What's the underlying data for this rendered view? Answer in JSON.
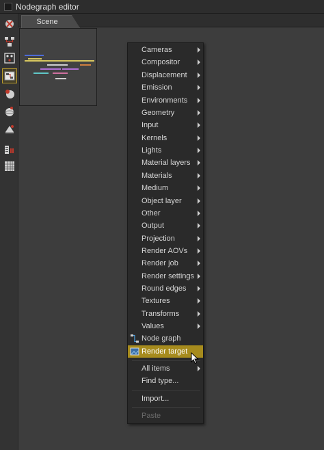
{
  "window": {
    "title": "Nodegraph editor"
  },
  "tabs": [
    {
      "label": "Scene"
    }
  ],
  "toolbar": {
    "tools": [
      {
        "name": "render-icon"
      },
      {
        "name": "nodes-icon"
      },
      {
        "name": "grid-nodes-icon"
      },
      {
        "name": "graph-icon",
        "active": true
      },
      {
        "name": "material-icon"
      },
      {
        "name": "sphere-icon"
      },
      {
        "name": "texture-icon"
      },
      {
        "name": "layers-icon"
      },
      {
        "name": "table-icon"
      }
    ]
  },
  "menu": {
    "categories": [
      "Cameras",
      "Compositor",
      "Displacement",
      "Emission",
      "Environments",
      "Geometry",
      "Input",
      "Kernels",
      "Lights",
      "Material layers",
      "Materials",
      "Medium",
      "Object layer",
      "Other",
      "Output",
      "Projection",
      "Render AOVs",
      "Render job",
      "Render settings",
      "Round edges",
      "Textures",
      "Transforms",
      "Values"
    ],
    "node_graph": "Node graph",
    "render_target": "Render target",
    "all_items": "All items",
    "find_type": "Find type...",
    "import": "Import...",
    "paste": "Paste"
  },
  "colors": {
    "highlight": "#a68b1d",
    "active_tool_border": "#b89a2c",
    "background": "#3b3b3b",
    "menu_bg": "#2a2a2a"
  }
}
